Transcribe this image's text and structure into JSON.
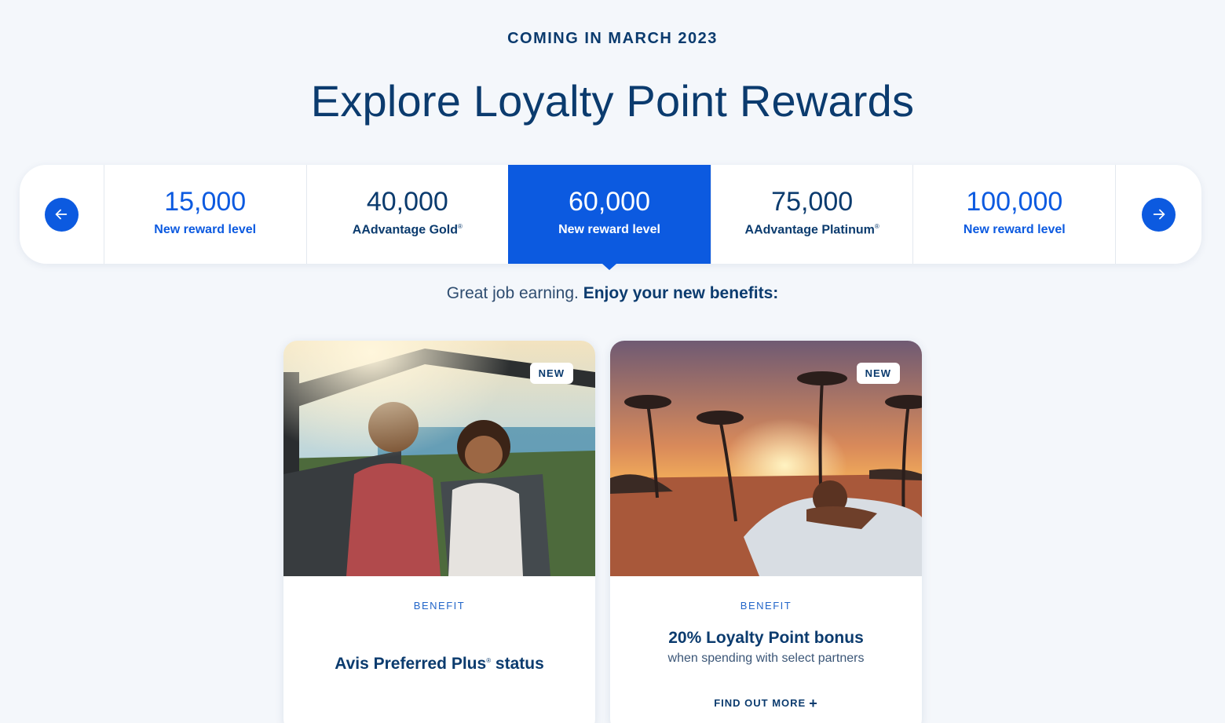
{
  "eyebrow": "COMING IN MARCH 2023",
  "title": "Explore Loyalty Point Rewards",
  "carousel": {
    "prev_icon": "arrow-left-icon",
    "next_icon": "arrow-right-icon",
    "tiers": [
      {
        "points": "15,000",
        "label": "New reward level"
      },
      {
        "points": "40,000",
        "label": "AAdvantage Gold",
        "mark": "®"
      },
      {
        "points": "60,000",
        "label": "New reward level",
        "active": true
      },
      {
        "points": "75,000",
        "label": "AAdvantage Platinum",
        "mark": "®"
      },
      {
        "points": "100,000",
        "label": "New reward level"
      }
    ]
  },
  "subline": {
    "lead": "Great job earning.",
    "emphasis": "Enjoy your new benefits:"
  },
  "cards": [
    {
      "badge": "NEW",
      "kicker": "BENEFIT",
      "headline": "Avis Preferred Plus",
      "mark": "®",
      "headline_suffix": " status"
    },
    {
      "badge": "NEW",
      "kicker": "BENEFIT",
      "headline": "20% Loyalty Point bonus",
      "description": "when spending with select partners",
      "cta": "FIND OUT MORE",
      "cta_icon": "plus-icon"
    }
  ],
  "colors": {
    "brand_blue": "#0c5ae0",
    "navy": "#0b3b6e",
    "background": "#f4f7fb"
  }
}
